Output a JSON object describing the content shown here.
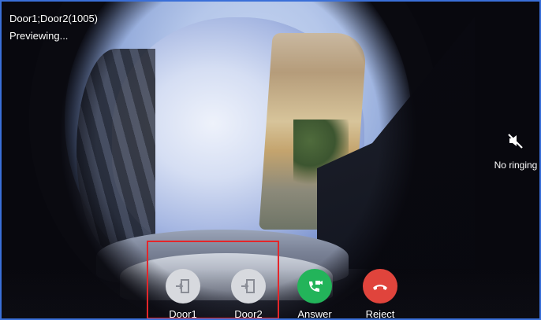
{
  "call": {
    "title": "Door1;Door2(1005)",
    "status": "Previewing..."
  },
  "ringing": {
    "label": "No ringing",
    "icon": "speaker-muted-icon"
  },
  "buttons": [
    {
      "label": "Door1",
      "icon": "door-open-icon",
      "color": "#d7d9de"
    },
    {
      "label": "Door2",
      "icon": "door-open-icon",
      "color": "#d7d9de"
    },
    {
      "label": "Answer",
      "icon": "video-call-icon",
      "color": "#23b45a"
    },
    {
      "label": "Reject",
      "icon": "hangup-icon",
      "color": "#e0443c"
    }
  ],
  "highlight": {
    "color": "#e4262a"
  }
}
